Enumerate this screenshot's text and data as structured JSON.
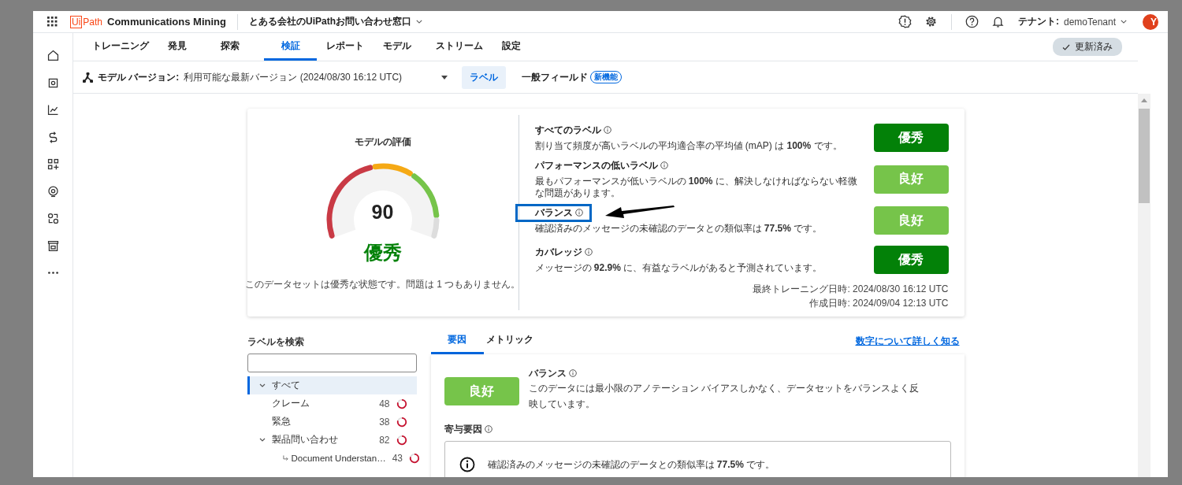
{
  "top_bar": {
    "logo": {
      "box": "Ui",
      "text": "Path"
    },
    "product": "Communications Mining",
    "workspace": "とある会社のUiPathお問い合わせ窓口",
    "tenant_label": "テナント:",
    "tenant": "demoTenant",
    "avatar": "Y"
  },
  "tabs": [
    {
      "label": "トレーニング",
      "selected": false
    },
    {
      "label": "発見",
      "selected": false
    },
    {
      "label": "探索",
      "selected": false
    },
    {
      "label": "検証",
      "selected": true
    },
    {
      "label": "レポート",
      "selected": false
    },
    {
      "label": "モデル",
      "selected": false
    },
    {
      "label": "ストリーム",
      "selected": false
    },
    {
      "label": "設定",
      "selected": false
    }
  ],
  "status_button": "更新済み",
  "model_bar": {
    "label": "モデル バージョン:",
    "value": "利用可能な最新バージョン (2024/08/30 16:12 UTC)",
    "views": [
      {
        "label": "ラベル",
        "selected": true
      },
      {
        "label": "一般フィールド",
        "selected": false,
        "badge": "新機能"
      }
    ]
  },
  "rating": {
    "title": "モデルの評価",
    "score": "90",
    "grade": "優秀",
    "summary": "このデータセットは優秀な状態です。問題は 1 つもありません。"
  },
  "metrics": [
    {
      "title": "すべてのラベル",
      "text": "割り当て頻度が高いラベルの平均適合率の平均値 (mAP) は **100%** です。",
      "kind": "excellent",
      "grade": "優秀",
      "highlighted": false
    },
    {
      "title": "パフォーマンスの低いラベル",
      "text": "最もパフォーマンスが低いラベルの **100%** に、解決しなければならない軽微な問題があります。",
      "kind": "good",
      "grade": "良好",
      "highlighted": false
    },
    {
      "title": "バランス",
      "text": "確認済みのメッセージの未確認のデータとの類似率は **77.5%** です。",
      "kind": "good",
      "grade": "良好",
      "highlighted": true
    },
    {
      "title": "カバレッジ",
      "text": "メッセージの **92.9%** に、有益なラベルがあると予測されています。",
      "kind": "excellent",
      "grade": "優秀",
      "highlighted": false
    }
  ],
  "timestamps": [
    "最終トレーニング日時: 2024/08/30 16:12 UTC",
    "作成日時: 2024/09/04 12:13 UTC"
  ],
  "label_search": {
    "title": "ラベルを検索",
    "tree": [
      {
        "label": "すべて",
        "selected": true,
        "expanded": true,
        "children": [
          {
            "label": "クレーム",
            "count": "48",
            "selected": false
          },
          {
            "label": "緊急",
            "count": "38",
            "selected": false
          },
          {
            "label": "製品問い合わせ",
            "count": "82",
            "selected": false,
            "expanded": true,
            "children": [
              {
                "label": "Document Understan…",
                "count": "43",
                "selected": false
              }
            ]
          }
        ]
      }
    ]
  },
  "detail": {
    "tabs": [
      {
        "label": "要因",
        "selected": true
      },
      {
        "label": "メトリック",
        "selected": false
      }
    ],
    "link": "数字について詳しく知る",
    "kind": "good",
    "grade": "良好",
    "title": "バランス",
    "text": "このデータには最小限のアノテーション バイアスしかなく、データセットをバランスよく反映しています。",
    "factors_title": "寄与要因",
    "factor": "確認済みのメッセージの未確認のデータとの類似率は **77.5%** です。"
  }
}
